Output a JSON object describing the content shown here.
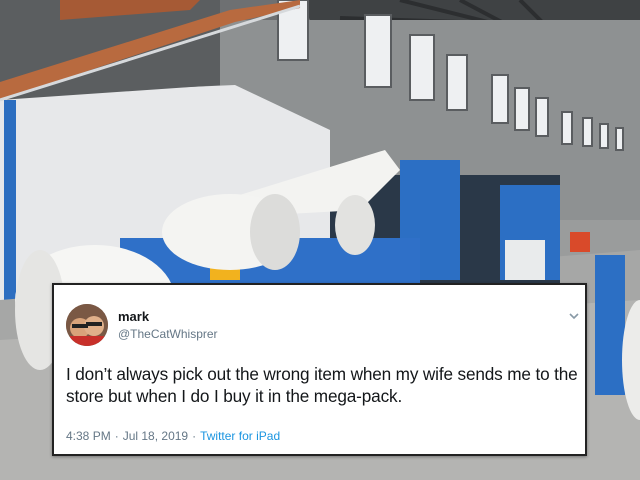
{
  "tweet": {
    "display_name": "mark",
    "handle": "@TheCatWhisprer",
    "text": "I don’t always pick out the wrong item when my wife sends me to the store but when I do I buy it in the mega-pack.",
    "time": "4:38 PM",
    "separator": "·",
    "date": "Jul 18, 2019",
    "source": "Twitter for iPad"
  },
  "icons": {
    "menu": "chevron-down-icon",
    "avatar": "profile-photo"
  },
  "colors": {
    "name": "#14171a",
    "secondary": "#657786",
    "link": "#1b95e0",
    "card_border": "#222222"
  }
}
